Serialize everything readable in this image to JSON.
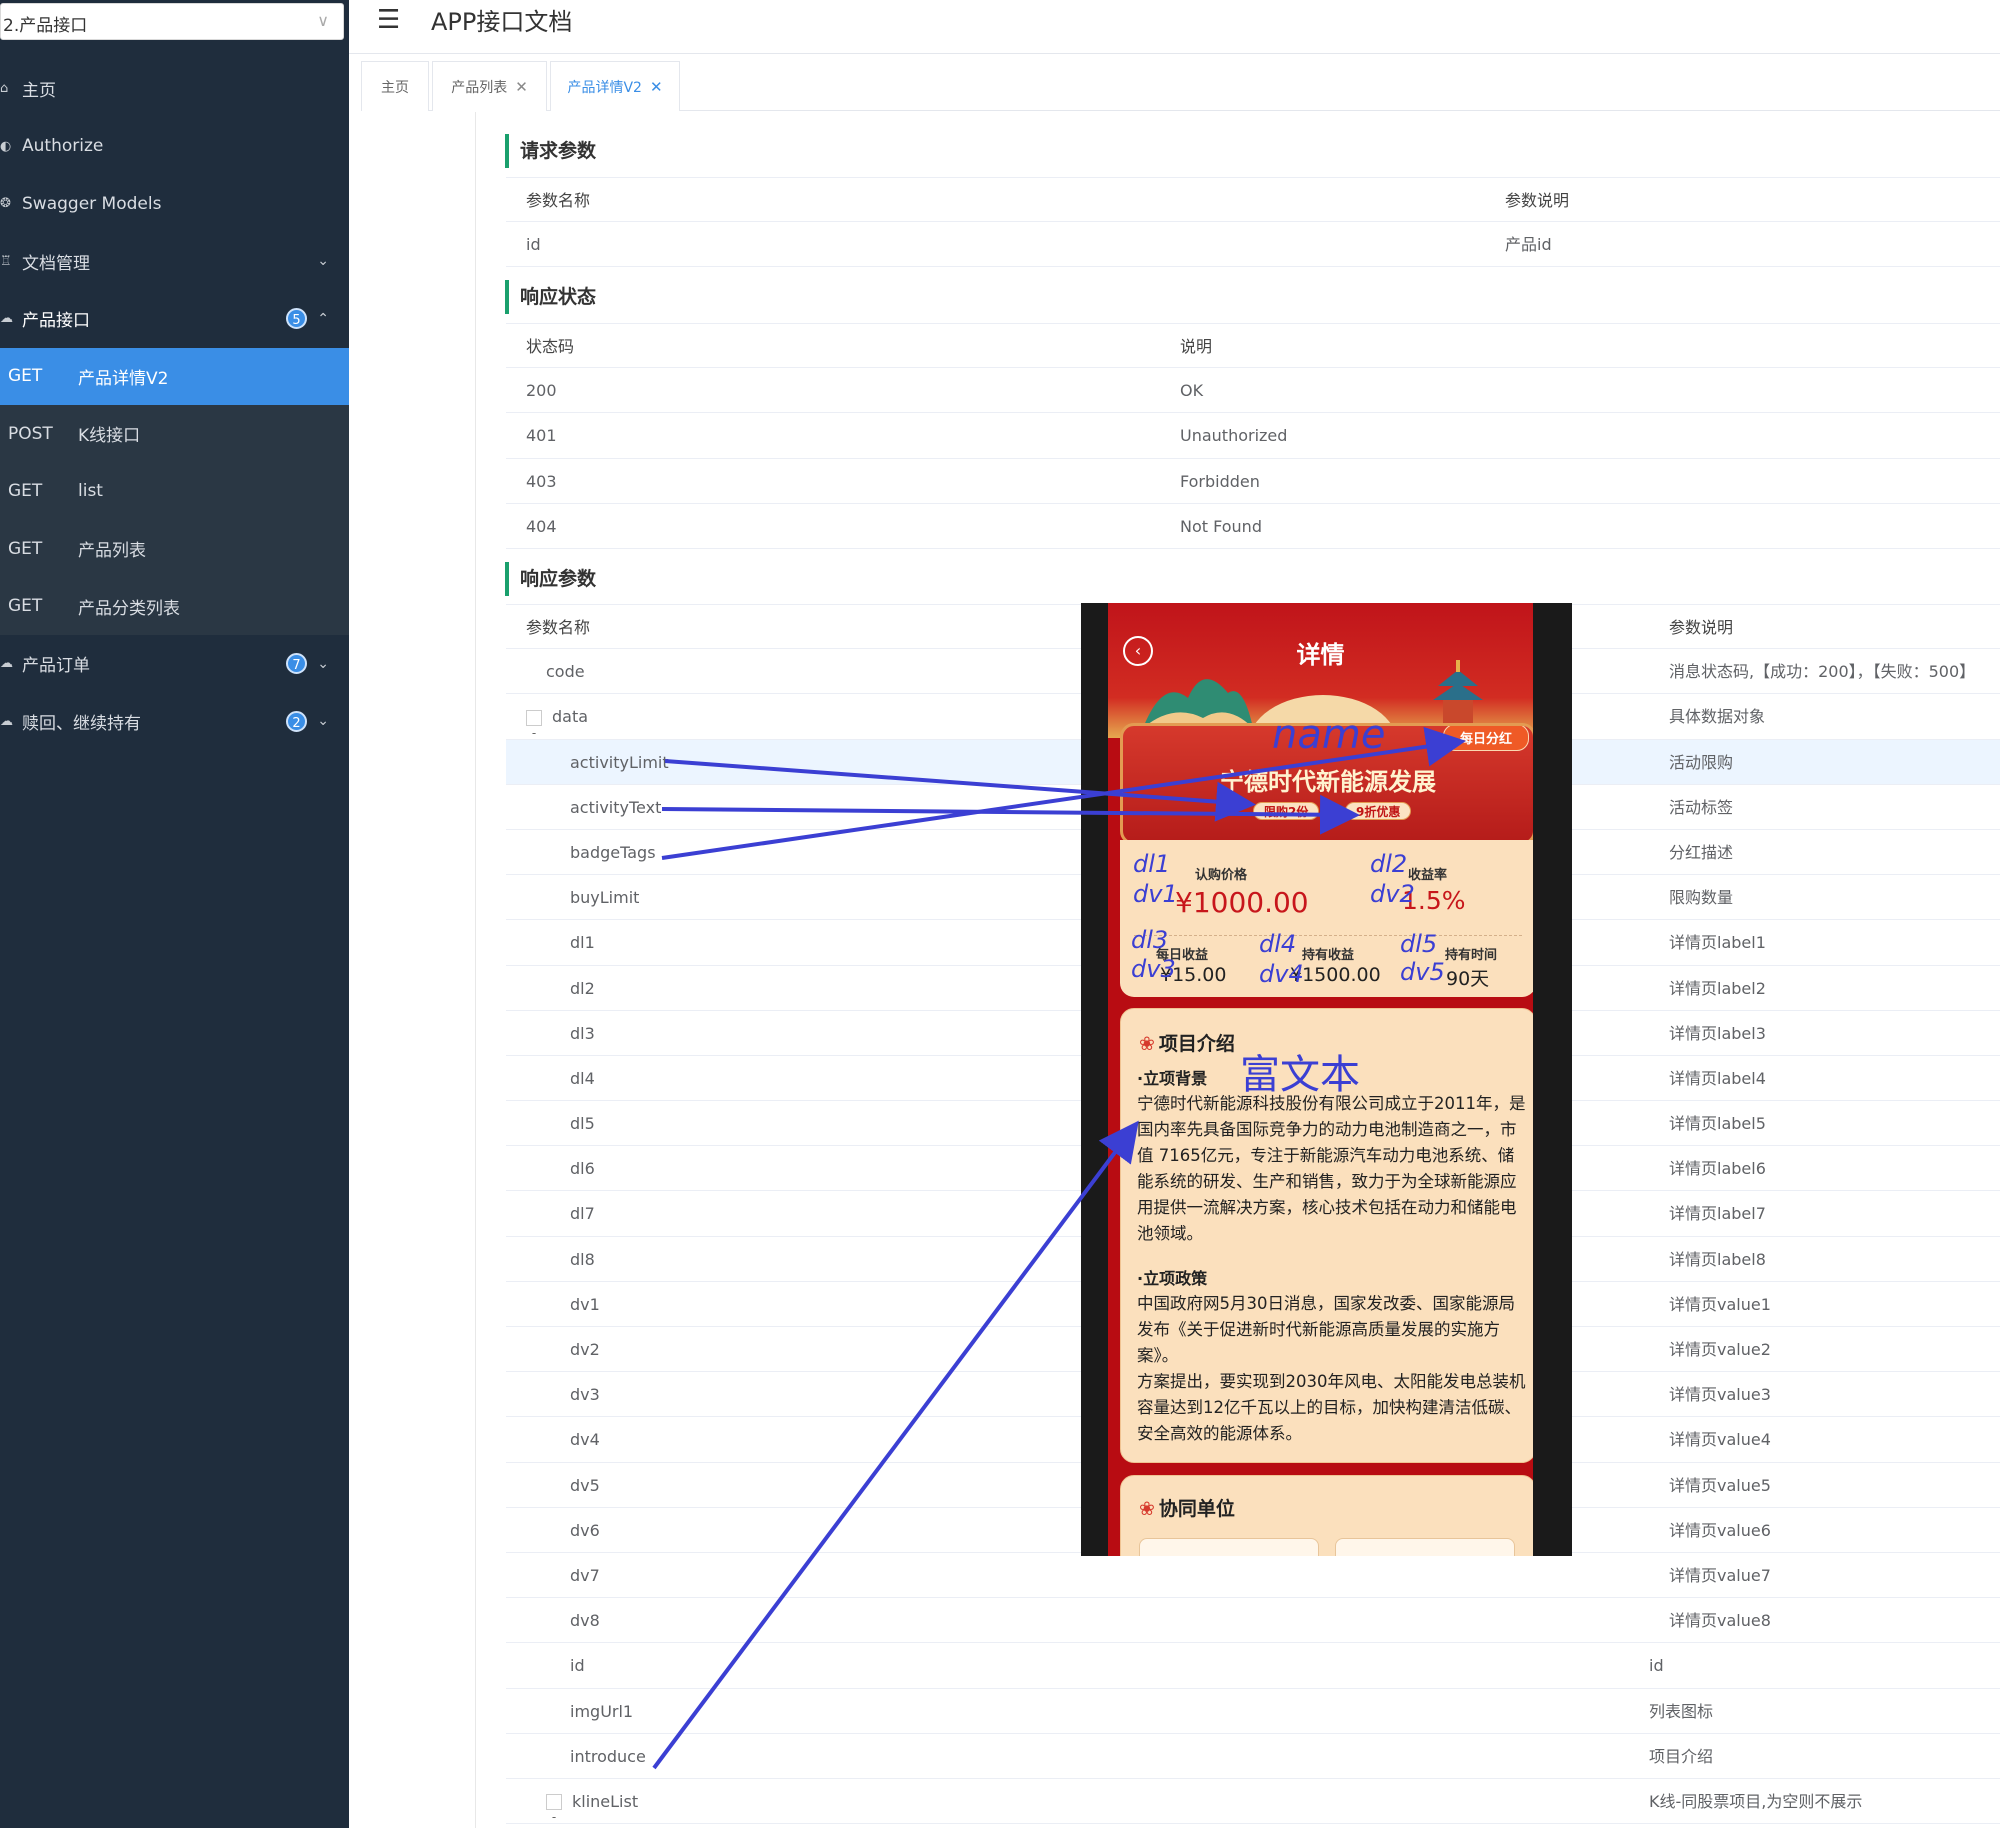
{
  "sidebar": {
    "select_value": "2.产品接口",
    "items": [
      {
        "label": "主页"
      },
      {
        "label": "Authorize"
      },
      {
        "label": "Swagger Models"
      },
      {
        "label": "文档管理"
      },
      {
        "label": "产品接口",
        "badge": "5"
      }
    ],
    "sub_items": [
      {
        "method": "GET",
        "label": "产品详情V2"
      },
      {
        "method": "POST",
        "label": "K线接口"
      },
      {
        "method": "GET",
        "label": "list"
      },
      {
        "method": "GET",
        "label": "产品列表"
      },
      {
        "method": "GET",
        "label": "产品分类列表"
      }
    ],
    "bottom_items": [
      {
        "label": "产品订单",
        "badge": "7"
      },
      {
        "label": "赎回、继续持有",
        "badge": "2"
      }
    ]
  },
  "header": {
    "title": "APP接口文档"
  },
  "tabs": [
    {
      "label": "主页"
    },
    {
      "label": "产品列表"
    },
    {
      "label": "产品详情V2"
    }
  ],
  "request_params": {
    "title": "请求参数",
    "headers": [
      "参数名称",
      "参数说明"
    ],
    "rows": [
      {
        "name": "id",
        "desc": "产品id"
      }
    ]
  },
  "response_status": {
    "title": "响应状态",
    "headers": [
      "状态码",
      "说明"
    ],
    "rows": [
      {
        "code": "200",
        "desc": "OK"
      },
      {
        "code": "401",
        "desc": "Unauthorized"
      },
      {
        "code": "403",
        "desc": "Forbidden"
      },
      {
        "code": "404",
        "desc": "Not Found"
      }
    ]
  },
  "response_params": {
    "title": "响应参数",
    "headers": [
      "参数名称",
      "参数说明"
    ],
    "rows": [
      {
        "name": "code",
        "desc": "消息状态码,【成功：200】，【失败：500】"
      },
      {
        "name": "data",
        "desc": "具体数据对象"
      },
      {
        "name": "activityLimit",
        "desc": "活动限购"
      },
      {
        "name": "activityText",
        "desc": "活动标签"
      },
      {
        "name": "badgeTags",
        "desc": "分红描述"
      },
      {
        "name": "buyLimit",
        "desc": "限购数量"
      },
      {
        "name": "dl1",
        "desc": "详情页label1"
      },
      {
        "name": "dl2",
        "desc": "详情页label2"
      },
      {
        "name": "dl3",
        "desc": "详情页label3"
      },
      {
        "name": "dl4",
        "desc": "详情页label4"
      },
      {
        "name": "dl5",
        "desc": "详情页label5"
      },
      {
        "name": "dl6",
        "desc": "详情页label6"
      },
      {
        "name": "dl7",
        "desc": "详情页label7"
      },
      {
        "name": "dl8",
        "desc": "详情页label8"
      },
      {
        "name": "dv1",
        "desc": "详情页value1"
      },
      {
        "name": "dv2",
        "desc": "详情页value2"
      },
      {
        "name": "dv3",
        "desc": "详情页value3"
      },
      {
        "name": "dv4",
        "desc": "详情页value4"
      },
      {
        "name": "dv5",
        "desc": "详情页value5"
      },
      {
        "name": "dv6",
        "desc": "详情页value6"
      },
      {
        "name": "dv7",
        "desc": "详情页value7"
      },
      {
        "name": "dv8",
        "desc": "详情页value8"
      },
      {
        "name": "id",
        "desc": "id"
      },
      {
        "name": "imgUrl1",
        "desc": "列表图标"
      },
      {
        "name": "introduce",
        "desc": "项目介绍"
      },
      {
        "name": "klineList",
        "desc": "K线-同股票项目,为空则不展示"
      }
    ]
  },
  "phone": {
    "title": "详情",
    "back_icon": "chevron-left-icon",
    "product_name": "宁德时代新能源发展",
    "badge": "每日分红",
    "tags": [
      "限购2份",
      "9折优惠"
    ],
    "label_price": "认购价格",
    "value_price": "¥1000.00",
    "label_rate": "收益率",
    "value_rate": "1.5%",
    "label_daily": "每日收益",
    "value_daily": "¥15.00",
    "label_hold": "持有收益",
    "value_hold": "¥1500.00",
    "label_time": "持有时间",
    "value_time": "90天",
    "intro_title": "项目介绍",
    "intro_sub1": "·立项背景",
    "intro_p1": "宁德时代新能源科技股份有限公司成立于2011年，是国内率先具备国际竞争力的动力电池制造商之一，市值 7165亿元，专注于新能源汽车动力电池系统、储能系统的研发、生产和销售，致力于为全球新能源应用提供一流解决方案，核心技术包括在动力和储能电池领域。",
    "intro_sub2": "·立项政策",
    "intro_p2": "中国政府网5月30日消息，国家发改委、国家能源局发布《关于促进新时代新能源高质量发展的实施方案》。",
    "intro_p3": "方案提出，要实现到2030年风电、太阳能发电总装机容量达到12亿千瓦以上的目标，加快构建清洁低碳、安全高效的能源体系。",
    "partners_title": "协同单位"
  },
  "annotations": {
    "name": "name",
    "dl1": "dl1",
    "dv1": "dv1",
    "dl2": "dl2",
    "dv2": "dv2",
    "dl3": "dl3",
    "dv3": "dv3",
    "dl4": "dl4",
    "dv4": "dv4",
    "dl5": "dl5",
    "dv5": "dv5",
    "rich_text": "富文本",
    "color": "#3b3fd3"
  }
}
